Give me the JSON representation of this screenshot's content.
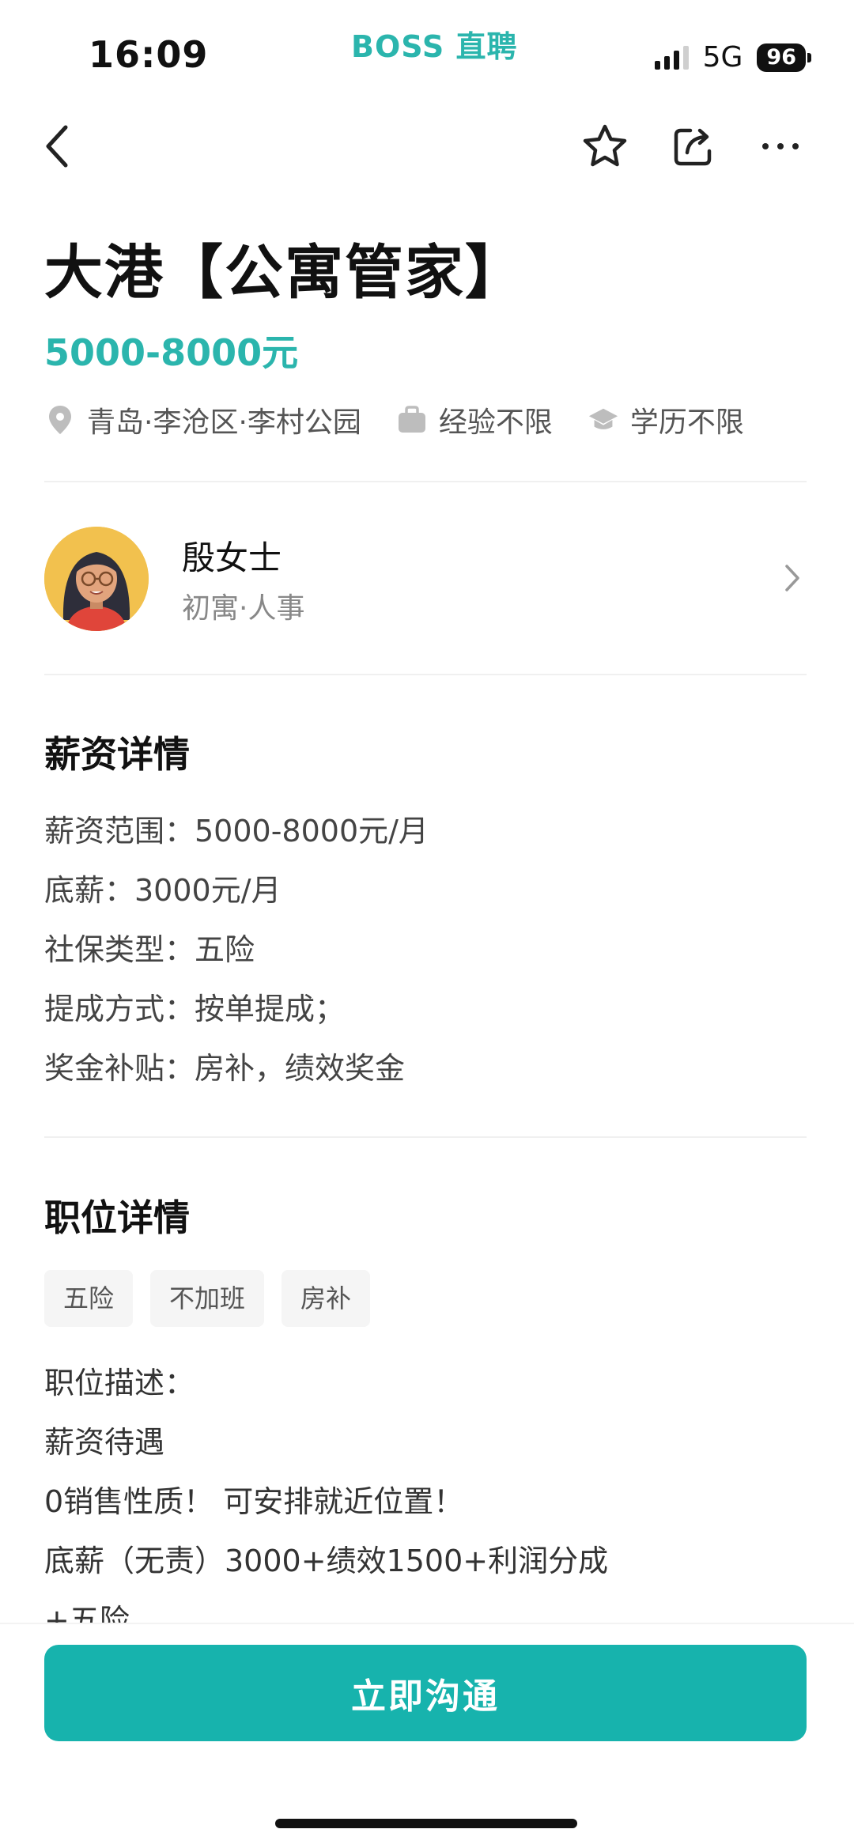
{
  "status_bar": {
    "time": "16:09",
    "brand": "BOSS 直聘",
    "network": "5G",
    "battery": "96"
  },
  "nav": {
    "back_icon": "chevron-left-icon",
    "favorite_icon": "star-outline-icon",
    "share_icon": "share-icon",
    "more_icon": "more-horizontal-icon"
  },
  "job": {
    "title": "大港【公寓管家】",
    "salary": "5000-8000元",
    "location": "青岛·李沧区·李村公园",
    "experience": "经验不限",
    "education": "学历不限"
  },
  "recruiter": {
    "name": "殷女士",
    "company": "初寓·人事"
  },
  "salary_details": {
    "title": "薪资详情",
    "lines": [
      "薪资范围：5000-8000元/月",
      "底薪：3000元/月",
      "社保类型：五险",
      "提成方式：按单提成；",
      "奖金补贴：房补，绩效奖金"
    ]
  },
  "job_details": {
    "title": "职位详情",
    "tags": [
      "五险",
      "不加班",
      "房补"
    ],
    "description_lines": [
      "职位描述：",
      "薪资待遇",
      "0销售性质！ 可安排就近位置！",
      "底薪（无责）3000+绩效1500+利润分成",
      "+五险"
    ]
  },
  "cta": {
    "label": "立即沟通"
  },
  "colors": {
    "brand": "#2bb5ad",
    "cta": "#17b3ad"
  }
}
